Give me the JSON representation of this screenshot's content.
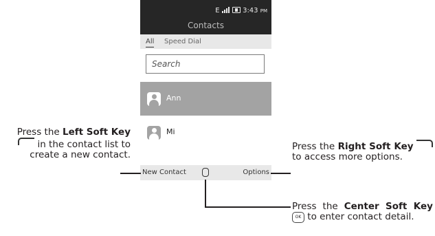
{
  "status_bar": {
    "network": "E",
    "time": "3:43",
    "ampm": "PM"
  },
  "header": {
    "title": "Contacts"
  },
  "tabs": [
    {
      "label": "All"
    },
    {
      "label": "Speed Dial"
    }
  ],
  "search": {
    "placeholder": "Search"
  },
  "contacts": [
    {
      "name": "Ann"
    },
    {
      "name": "Mi"
    }
  ],
  "softkeys": {
    "left": "New Contact",
    "right": "Options"
  },
  "callouts": {
    "left": {
      "pre": "Press the ",
      "bold": "Left Soft Key",
      "post": " in the contact list to create a new contact."
    },
    "right": {
      "pre": "Press the ",
      "bold": "Right Soft Key",
      "post": " to access more options."
    },
    "center": {
      "pre": "Press the ",
      "bold": "Center Soft Key",
      "post": " to enter contact detail."
    }
  },
  "colors": {
    "status_bar_bg": "#262626",
    "highlight_row": "#a3a3a3",
    "bar_bg": "#e8e8e8"
  }
}
